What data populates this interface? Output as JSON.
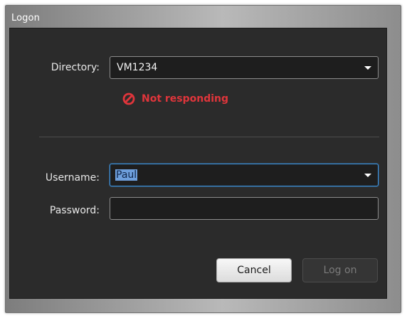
{
  "window": {
    "title": "Logon"
  },
  "directory": {
    "label": "Directory:",
    "value": "VM1234"
  },
  "status": {
    "text": "Not responding",
    "icon": "ban-icon",
    "color": "#e0353b"
  },
  "username": {
    "label": "Username:",
    "value": "Paul"
  },
  "password": {
    "label": "Password:",
    "value": ""
  },
  "buttons": {
    "cancel": "Cancel",
    "logon": "Log on"
  },
  "colors": {
    "focus_accent": "#3c8fd8",
    "dialog_background": "#2b2b2b"
  }
}
